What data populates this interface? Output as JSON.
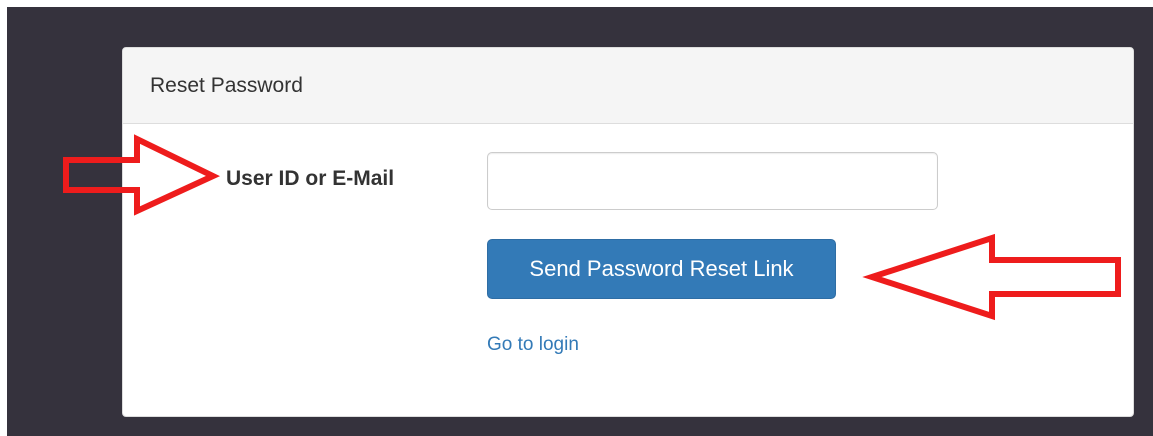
{
  "panel": {
    "heading": "Reset Password"
  },
  "form": {
    "user_label": "User ID or E-Mail",
    "user_input_value": "",
    "submit_label": "Send Password Reset Link",
    "login_link_label": "Go to login"
  },
  "annotations": {
    "arrow_color": "#ee1c1c",
    "arrow_icon": "right-arrow-outline-icon / left-arrow-outline-icon"
  },
  "colors": {
    "background_dark": "#35323d",
    "panel_heading_bg": "#f5f5f5",
    "primary_button": "#337ab7",
    "link": "#337ab7"
  }
}
